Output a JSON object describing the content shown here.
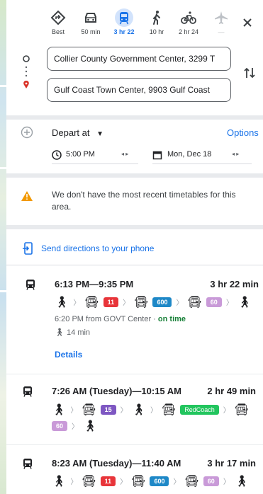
{
  "modes": [
    {
      "name": "Best",
      "label": "Best",
      "icon": "diamond-route-icon"
    },
    {
      "name": "Driving",
      "label": "50 min",
      "icon": "car-icon"
    },
    {
      "name": "Transit",
      "label": "3 hr 22",
      "icon": "train-icon"
    },
    {
      "name": "Walking",
      "label": "10 hr",
      "icon": "walk-icon"
    },
    {
      "name": "Cycling",
      "label": "2 hr 24",
      "icon": "bike-icon"
    },
    {
      "name": "Flights",
      "label": "—",
      "icon": "plane-icon"
    }
  ],
  "origin": {
    "value": "Collier County Government Center, 3299 T"
  },
  "destination": {
    "value": "Gulf Coast Town Center, 9903 Gulf Coast"
  },
  "depart": {
    "label": "Depart at",
    "options_label": "Options",
    "time": "5:00 PM",
    "date": "Mon, Dec 18"
  },
  "warning": {
    "text": "We don't have the most recent timetables for this area."
  },
  "send": {
    "label": "Send directions to your phone"
  },
  "trips": [
    {
      "time": "6:13 PM—9:35 PM",
      "duration": "3 hr 22 min",
      "lines": [
        {
          "label": "11",
          "color": "#e8353a"
        },
        {
          "label": "600",
          "color": "#1e88c7"
        },
        {
          "label": "60",
          "color": "#c99ad8"
        }
      ],
      "from": "6:20 PM from GOVT Center · ",
      "status": "on time",
      "walk": "14 min",
      "details_label": "Details"
    },
    {
      "time": "7:26 AM (Tuesday)—10:15 AM",
      "duration": "2 hr 49 min",
      "lines": [
        {
          "label": "15",
          "color": "#7e57c2"
        },
        {
          "label": "RedCoach",
          "color": "#22c55e"
        },
        {
          "label": "60",
          "color": "#c99ad8"
        }
      ]
    },
    {
      "time": "8:23 AM (Tuesday)—11:40 AM",
      "duration": "3 hr 17 min",
      "lines": [
        {
          "label": "11",
          "color": "#e8353a"
        },
        {
          "label": "600",
          "color": "#1e88c7"
        },
        {
          "label": "60",
          "color": "#c99ad8"
        }
      ]
    }
  ],
  "colors": {
    "accent": "#1a73e8",
    "warning": "#f29900",
    "on_time": "#188038"
  }
}
